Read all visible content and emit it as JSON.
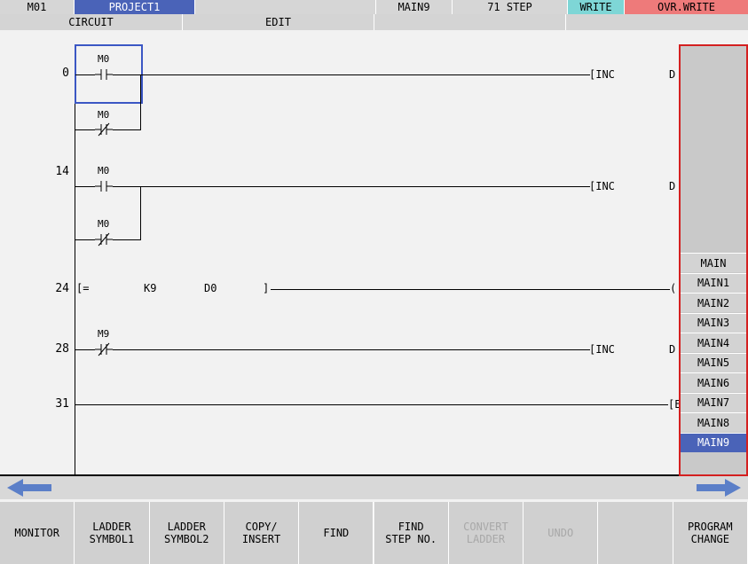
{
  "status_bar": {
    "station": "M01",
    "project": "PROJECT1",
    "program": "MAIN9",
    "steps": "71 STEP",
    "mode_write": "WRITE",
    "mode_ovr": "OVR.WRITE"
  },
  "sub_bar": {
    "circuit": "CIRCUIT",
    "edit": "EDIT"
  },
  "colors": {
    "project_bg": "#4a63b8",
    "write_bg": "#7ed6d6",
    "ovr_bg": "#ee7a7a",
    "selected_program": "#4a63b8",
    "panel_border": "#d42020",
    "cursor": "#3b57c4"
  },
  "ladder": {
    "rung0": {
      "step": "0",
      "contact_a": "M0",
      "contact_b": "M0",
      "instr": "[INC",
      "dev": "D"
    },
    "rung14": {
      "step": "14",
      "contact_a": "M0",
      "contact_b": "M0",
      "instr": "[INC",
      "dev": "D"
    },
    "rung24": {
      "step": "24",
      "open": "[=",
      "op1": "K9",
      "op2": "D0",
      "close": "]",
      "coil": "("
    },
    "rung28": {
      "step": "28",
      "contact": "M9",
      "instr": "[INC",
      "dev": "D"
    },
    "rung31": {
      "step": "31",
      "instr": "[E"
    }
  },
  "program_list": [
    {
      "label": "MAIN",
      "selected": false
    },
    {
      "label": "MAIN1",
      "selected": false
    },
    {
      "label": "MAIN2",
      "selected": false
    },
    {
      "label": "MAIN3",
      "selected": false
    },
    {
      "label": "MAIN4",
      "selected": false
    },
    {
      "label": "MAIN5",
      "selected": false
    },
    {
      "label": "MAIN6",
      "selected": false
    },
    {
      "label": "MAIN7",
      "selected": false
    },
    {
      "label": "MAIN8",
      "selected": false
    },
    {
      "label": "MAIN9",
      "selected": true
    }
  ],
  "arrows": {
    "left": "arrow-left-icon",
    "right": "arrow-right-icon"
  },
  "function_keys": [
    {
      "line1": "MONITOR",
      "line2": "",
      "enabled": true
    },
    {
      "line1": "LADDER",
      "line2": "SYMBOL1",
      "enabled": true
    },
    {
      "line1": "LADDER",
      "line2": "SYMBOL2",
      "enabled": true
    },
    {
      "line1": "COPY/",
      "line2": "INSERT",
      "enabled": true
    },
    {
      "line1": "FIND",
      "line2": "",
      "enabled": true
    },
    {
      "line1": "FIND",
      "line2": "STEP NO.",
      "enabled": true
    },
    {
      "line1": "CONVERT",
      "line2": "LADDER",
      "enabled": false
    },
    {
      "line1": "UNDO",
      "line2": "",
      "enabled": false
    },
    {
      "line1": "",
      "line2": "",
      "enabled": false
    },
    {
      "line1": "PROGRAM",
      "line2": "CHANGE",
      "enabled": true
    }
  ]
}
